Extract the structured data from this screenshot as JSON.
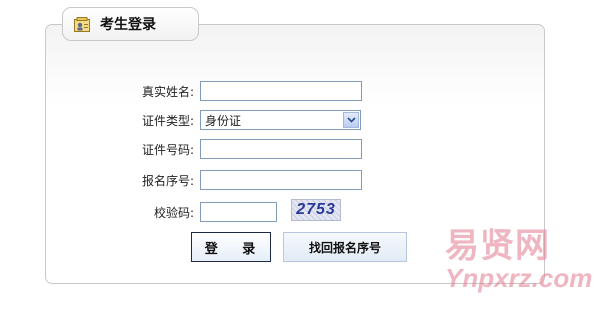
{
  "panel": {
    "title": "考生登录",
    "title_icon": "user-card-icon"
  },
  "form": {
    "name_label": "真实姓名:",
    "id_type_label": "证件类型:",
    "id_type_value": "身份证",
    "id_number_label": "证件号码:",
    "reg_number_label": "报名序号:",
    "captcha_label": "校验码:",
    "captcha_text": "2753"
  },
  "buttons": {
    "login_label": "登 录",
    "find_label": "找回报名序号"
  },
  "watermark": {
    "top": "易贤网",
    "bottom": "Ynpxrz.com"
  },
  "colors": {
    "input_border": "#7f9db9",
    "watermark": "#e1788c"
  }
}
